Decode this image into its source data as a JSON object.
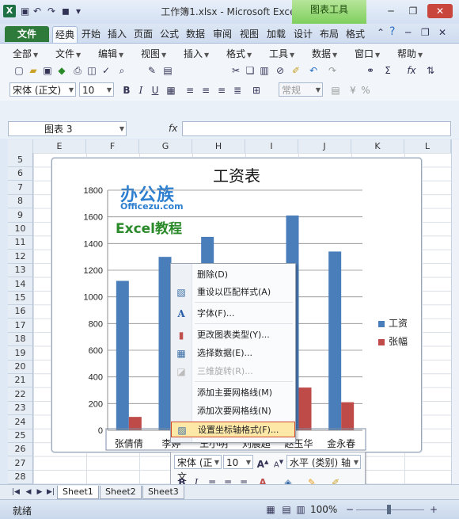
{
  "window": {
    "title": "工作簿1.xlsx - Microsoft Excel",
    "context_tools": "图表工具",
    "app_icon": "excel-logo"
  },
  "ribbon_tabs": [
    "文件",
    "经典",
    "开始",
    "插入",
    "页面",
    "公式",
    "数据",
    "审阅",
    "视图",
    "加载",
    "设计",
    "布局",
    "格式"
  ],
  "menubar": [
    "全部",
    "文件",
    "编辑",
    "视图",
    "插入",
    "格式",
    "工具",
    "数据",
    "窗口",
    "帮助"
  ],
  "toolbar": {
    "font_name": "宋体 (正文)",
    "font_size": "10",
    "number_format": "常规",
    "percent_symbol": "%"
  },
  "formula_bar": {
    "name_box": "图表 3",
    "fx_label": "fx",
    "formula": ""
  },
  "grid": {
    "columns": [
      "E",
      "F",
      "G",
      "H",
      "I",
      "J",
      "K",
      "L"
    ],
    "rows": [
      "5",
      "6",
      "7",
      "8",
      "9",
      "10",
      "11",
      "12",
      "13",
      "14",
      "15",
      "16",
      "17",
      "18",
      "19",
      "20",
      "21",
      "22",
      "23",
      "24",
      "25",
      "26",
      "27",
      "28",
      "29"
    ]
  },
  "watermark": {
    "brand": "办公族",
    "site": "Officezu.com",
    "tagline": "Excel教程"
  },
  "chart_data": {
    "type": "bar",
    "title": "工资表",
    "categories": [
      "张倩倩",
      "李婷",
      "王小明",
      "刘晨超",
      "赵玉华",
      "金永春"
    ],
    "series": [
      {
        "name": "工资",
        "values": [
          1120,
          1300,
          1450,
          1100,
          1610,
          1340
        ],
        "color": "#4a7ebb"
      },
      {
        "name": "张幅",
        "values": [
          100,
          0,
          0,
          0,
          320,
          210
        ],
        "color": "#be4b48"
      }
    ],
    "y_ticks": [
      "0",
      "200",
      "400",
      "600",
      "800",
      "1000",
      "1200",
      "1400",
      "1600",
      "1800"
    ],
    "ylim": [
      0,
      1800
    ],
    "grid": true,
    "legend_position": "right"
  },
  "context_menu": {
    "items": [
      {
        "label": "删除(D)",
        "icon": "",
        "enabled": true
      },
      {
        "label": "重设以匹配样式(A)",
        "icon": "reset-style-icon",
        "enabled": true
      },
      {
        "label": "字体(F)...",
        "icon": "font-icon",
        "enabled": true
      },
      {
        "label": "更改图表类型(Y)...",
        "icon": "chart-type-icon",
        "enabled": true
      },
      {
        "label": "选择数据(E)...",
        "icon": "select-data-icon",
        "enabled": true
      },
      {
        "label": "三维旋转(R)...",
        "icon": "rotate-3d-icon",
        "enabled": false
      },
      {
        "label": "添加主要网格线(M)",
        "icon": "",
        "enabled": true
      },
      {
        "label": "添加次要网格线(N)",
        "icon": "",
        "enabled": true
      },
      {
        "label": "设置坐标轴格式(F)...",
        "icon": "format-axis-icon",
        "enabled": true,
        "highlighted": true
      }
    ]
  },
  "mini_toolbar": {
    "font_name": "宋体 (正文",
    "font_size": "10",
    "element_select": "水平 (类别) 轴"
  },
  "sheets": [
    "Sheet1",
    "Sheet2",
    "Sheet3"
  ],
  "status": {
    "mode": "就绪",
    "zoom": "100%",
    "zoom_minus": "−",
    "zoom_plus": "+"
  }
}
